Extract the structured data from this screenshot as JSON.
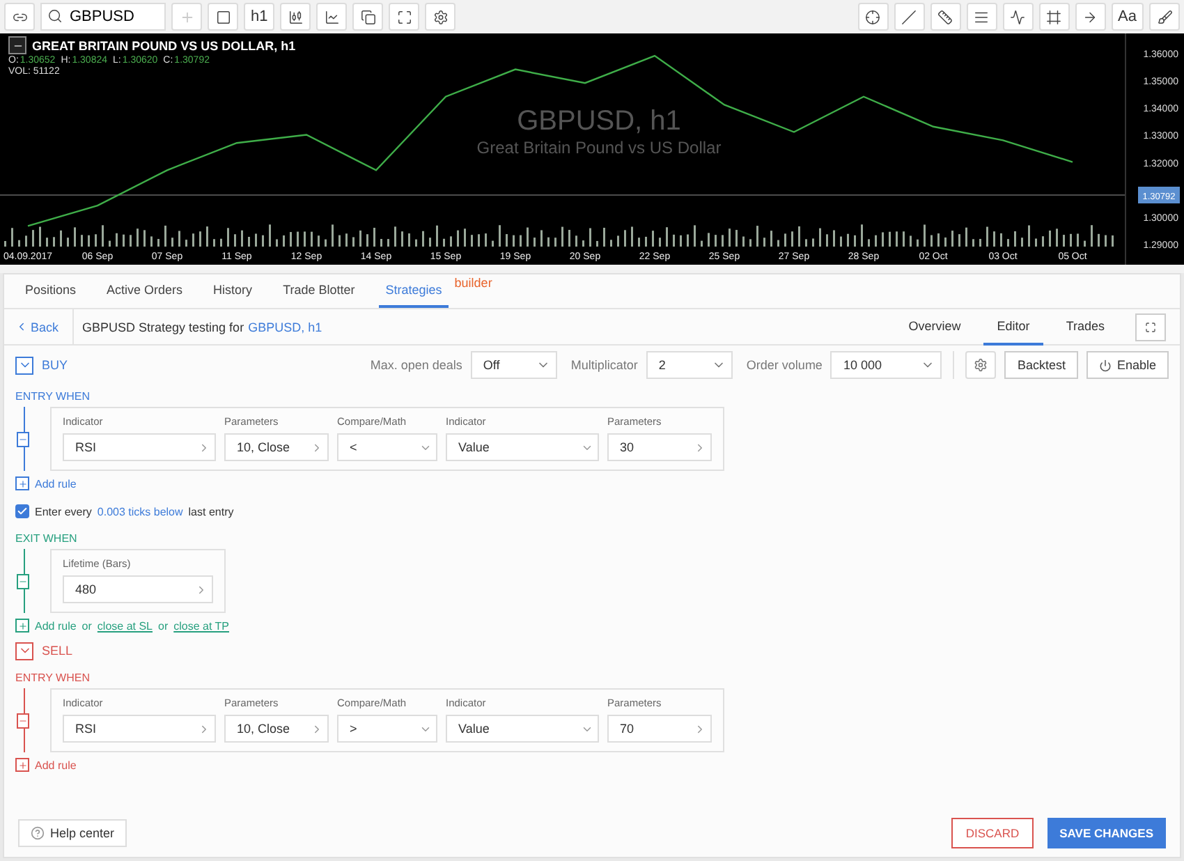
{
  "toolbar": {
    "search": {
      "value": "GBPUSD"
    },
    "timeframe": "h1",
    "text_tool": "Aa"
  },
  "chart": {
    "title": "GREAT BRITAIN POUND VS US DOLLAR, h1",
    "ohlc": [
      {
        "label": "O:",
        "value": "1.30652"
      },
      {
        "label": "H:",
        "value": "1.30824"
      },
      {
        "label": "L:",
        "value": "1.30620"
      },
      {
        "label": "C:",
        "value": "1.30792"
      }
    ],
    "volume": "VOL: 51122",
    "watermark_symbol": "GBPUSD, h1",
    "watermark_name": "Great Britain Pound vs US Dollar",
    "price_tag": "1.30792",
    "chart_data": {
      "type": "line",
      "categories": [
        "04.09.2017",
        "06 Sep",
        "07 Sep",
        "11 Sep",
        "12 Sep",
        "14 Sep",
        "15 Sep",
        "19 Sep",
        "20 Sep",
        "22 Sep",
        "25 Sep",
        "27 Sep",
        "28 Sep",
        "02 Oct",
        "03 Oct",
        "05 Oct"
      ],
      "series": [
        {
          "color": "#3fae49",
          "values": [
            1.2965,
            1.304,
            1.317,
            1.327,
            1.33,
            1.317,
            1.344,
            1.354,
            1.349,
            1.359,
            1.341,
            1.331,
            1.344,
            1.333,
            1.328,
            1.32
          ]
        }
      ],
      "ylim": [
        1.2823,
        1.3672
      ],
      "yticks": [
        {
          "value": 1.29,
          "label": "1.29000"
        },
        {
          "value": 1.3,
          "label": "1.30000"
        },
        {
          "value": 1.32,
          "label": "1.32000"
        },
        {
          "value": 1.33,
          "label": "1.33000"
        },
        {
          "value": 1.34,
          "label": "1.34000"
        },
        {
          "value": 1.35,
          "label": "1.35000"
        },
        {
          "value": 1.36,
          "label": "1.36000"
        }
      ]
    }
  },
  "tabs": [
    {
      "label": "Positions",
      "selected": false
    },
    {
      "label": "Active Orders",
      "selected": false
    },
    {
      "label": "History",
      "selected": false
    },
    {
      "label": "Trade Blotter",
      "selected": false
    },
    {
      "label": "Strategies",
      "selected": true,
      "badge": "builder"
    }
  ],
  "strategy_header": {
    "back": "Back",
    "title": "GBPUSD Strategy testing for",
    "link": "GBPUSD, h1",
    "view_tabs": [
      {
        "label": "Overview",
        "selected": false
      },
      {
        "label": "Editor",
        "selected": true
      },
      {
        "label": "Trades",
        "selected": false
      }
    ]
  },
  "settings": [
    {
      "label": "Max. open deals",
      "value": "Off"
    },
    {
      "label": "Multiplicator",
      "value": "2"
    },
    {
      "label": "Order volume",
      "value": "10 000"
    }
  ],
  "actions": {
    "backtest": "Backtest",
    "enable": "Enable"
  },
  "sides": [
    {
      "kind": "buy",
      "label": "BUY",
      "expanded": true,
      "entry": {
        "title": "ENTRY WHEN",
        "rules": [
          {
            "cells": [
              {
                "label": "Indicator",
                "value": "RSI",
                "kind": "picker"
              },
              {
                "label": "Parameters",
                "value": "10, Close",
                "kind": "picker"
              },
              {
                "label": "Compare/Math",
                "value": "<",
                "kind": "select"
              },
              {
                "label": "Indicator",
                "value": "Value",
                "kind": "select"
              },
              {
                "label": "Parameters",
                "value": "30",
                "kind": "picker"
              }
            ]
          }
        ],
        "add": "Add rule"
      },
      "repeat": {
        "checked": true,
        "before": "Enter every",
        "link": "0.003 ticks below",
        "after": "last entry"
      },
      "exit": {
        "title": "EXIT WHEN",
        "fields": [
          {
            "label": "Lifetime (Bars)",
            "value": "480",
            "kind": "picker"
          }
        ],
        "add": "Add rule",
        "or_1": "or",
        "sl": "close at SL",
        "or_2": "or",
        "tp": "close at TP"
      }
    },
    {
      "kind": "sell",
      "label": "SELL",
      "expanded": true,
      "entry": {
        "title": "ENTRY WHEN",
        "rules": [
          {
            "cells": [
              {
                "label": "Indicator",
                "value": "RSI",
                "kind": "picker"
              },
              {
                "label": "Parameters",
                "value": "10, Close",
                "kind": "picker"
              },
              {
                "label": "Compare/Math",
                "value": ">",
                "kind": "select"
              },
              {
                "label": "Indicator",
                "value": "Value",
                "kind": "select"
              },
              {
                "label": "Parameters",
                "value": "70",
                "kind": "picker"
              }
            ]
          }
        ],
        "add": "Add rule"
      }
    }
  ],
  "footer": {
    "help": "Help center",
    "discard": "DISCARD",
    "save": "SAVE CHANGES"
  }
}
